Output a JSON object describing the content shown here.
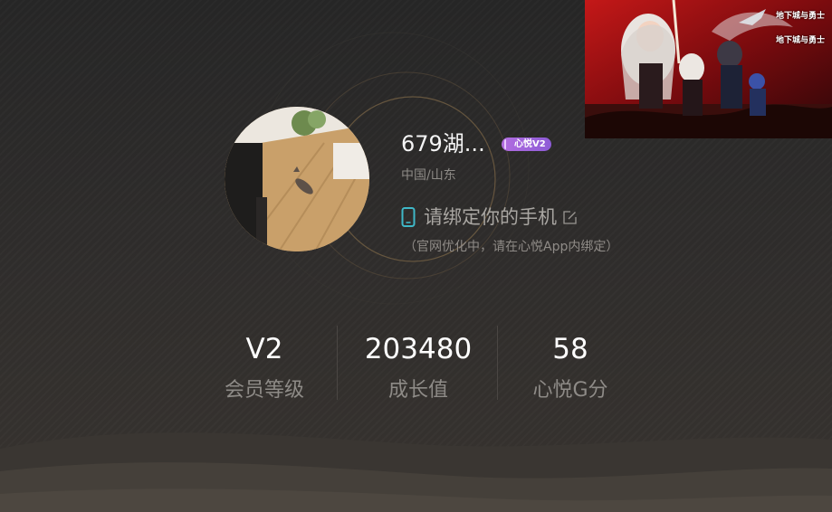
{
  "profile": {
    "name": "679湖...",
    "vip_badge": "心悦V2",
    "location": "中国/山东",
    "phone_label": "请绑定你的手机",
    "bind_note": "（官网优化中，请在心悦App内绑定）"
  },
  "stats": [
    {
      "value": "V2",
      "label": "会员等级"
    },
    {
      "value": "203480",
      "label": "成长值"
    },
    {
      "value": "58",
      "label": "心悦G分"
    }
  ],
  "video": {
    "logo_line1": "地下城与勇士",
    "logo_line2": "地下城与勇士"
  },
  "colors": {
    "background": "#2e2c2b",
    "phone_icon": "#3fb8c8",
    "badge": "#a665dc",
    "ring": "#6e5a3e"
  }
}
